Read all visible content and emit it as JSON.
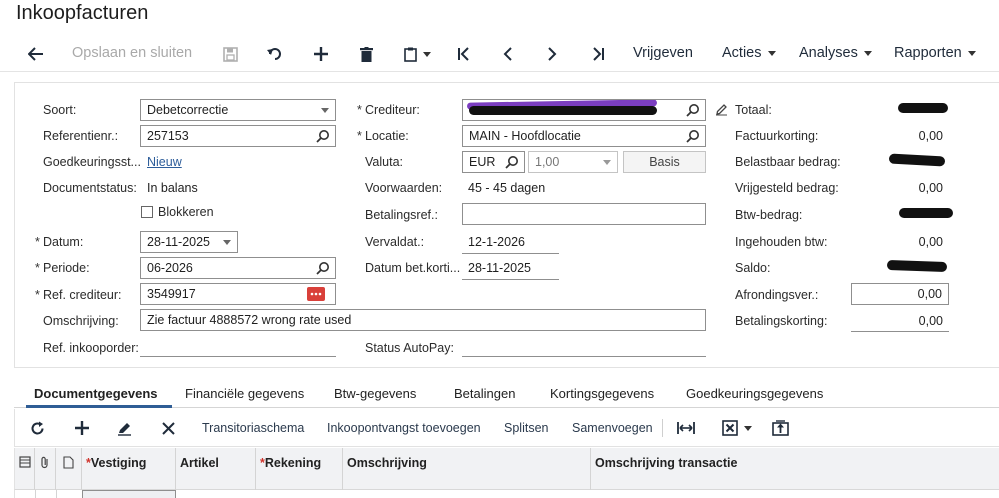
{
  "title": "Inkoopfacturen",
  "toolbar": {
    "save_close": "Opslaan en sluiten",
    "release": "Vrijgeven",
    "actions": "Acties",
    "analyses": "Analyses",
    "reports": "Rapporten"
  },
  "form": {
    "type_label": "Soort:",
    "type_value": "Debetcorrectie",
    "ref_label": "Referentienr.:",
    "ref_value": "257153",
    "approval_label": "Goedkeuringsst...",
    "approval_value": "Nieuw",
    "docstatus_label": "Documentstatus:",
    "docstatus_value": "In balans",
    "block_label": "Blokkeren",
    "date_label": "Datum:",
    "date_value": "28-11-2025",
    "period_label": "Periode:",
    "period_value": "06-2026",
    "vendorref_label": "Ref. crediteur:",
    "vendorref_value": "3549917",
    "desc_label": "Omschrijving:",
    "desc_value": "Zie factuur 4888572 wrong rate used",
    "po_label": "Ref. inkooporder:",
    "vendor_label": "Crediteur:",
    "location_label": "Locatie:",
    "location_value": "MAIN - Hoofdlocatie",
    "currency_label": "Valuta:",
    "currency_value": "EUR",
    "rate_value": "1,00",
    "base_button": "Basis",
    "terms_label": "Voorwaarden:",
    "terms_value": "45 - 45 dagen",
    "payref_label": "Betalingsref.:",
    "due_label": "Vervaldat.:",
    "due_value": "12-1-2026",
    "discdate_label": "Datum bet.korti...",
    "discdate_value": "28-11-2025",
    "autopay_label": "Status AutoPay:"
  },
  "totals": {
    "total_label": "Totaal:",
    "invdisc_label": "Factuurkorting:",
    "invdisc_value": "0,00",
    "taxable_label": "Belastbaar bedrag:",
    "exempt_label": "Vrijgesteld bedrag:",
    "exempt_value": "0,00",
    "vat_label": "Btw-bedrag:",
    "withheld_label": "Ingehouden btw:",
    "withheld_value": "0,00",
    "balance_label": "Saldo:",
    "rounding_label": "Afrondingsver.:",
    "rounding_value": "0,00",
    "paydisc_label": "Betalingskorting:",
    "paydisc_value": "0,00"
  },
  "tabs": [
    {
      "label": "Documentgegevens"
    },
    {
      "label": "Financiële gegevens"
    },
    {
      "label": "Btw-gegevens"
    },
    {
      "label": "Betalingen"
    },
    {
      "label": "Kortingsgegevens"
    },
    {
      "label": "Goedkeuringsgegevens"
    }
  ],
  "gridbar": {
    "transitorial": "Transitoriaschema",
    "add_receipt": "Inkoopontvangst toevoegen",
    "split": "Splitsen",
    "merge": "Samenvoegen"
  },
  "grid": {
    "columns": [
      "Vestiging",
      "Artikel",
      "Rekening",
      "Omschrijving",
      "Omschrijving transactie"
    ]
  },
  "colors": {
    "accent": "#2f5d95",
    "required": "#d0342c",
    "link": "#2d5d9a"
  }
}
